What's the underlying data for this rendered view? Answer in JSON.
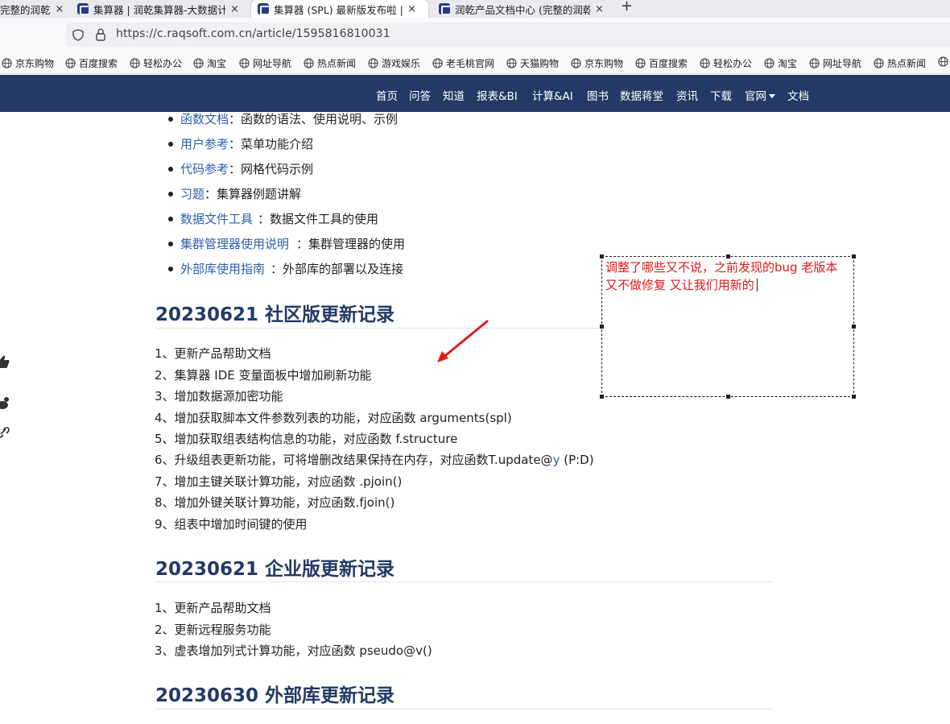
{
  "browser": {
    "tabs": [
      {
        "title": "完整的润乾",
        "active": false,
        "favicon": "none"
      },
      {
        "title": "集算器 | 润乾集算器-大数据计算",
        "active": false,
        "favicon": "raqsoft-icon"
      },
      {
        "title": "集算器 (SPL) 最新版发布啦 | 乾学",
        "active": true,
        "favicon": "raqsoft-icon"
      },
      {
        "title": "润乾产品文档中心 (完整的润乾",
        "active": false,
        "favicon": "raqsoft-icon"
      }
    ],
    "tab_close": "×",
    "new_tab": "+",
    "url": "https://c.raqsoft.com.cn/article/1595816810031",
    "bookmarks": [
      "京东购物",
      "百度搜索",
      "轻松办公",
      "淘宝",
      "网址导航",
      "热点新闻",
      "游戏娱乐",
      "老毛桃官网",
      "天猫购物",
      "京东购物",
      "百度搜索",
      "轻松办公",
      "淘宝",
      "网址导航",
      "热点新闻"
    ]
  },
  "site_nav": {
    "items": [
      "首页",
      "问答",
      "知道",
      "报表&BI",
      "计算&AI",
      "图书",
      "数据蒋堂",
      "资讯",
      "下载",
      "官网",
      "文档"
    ]
  },
  "doc_links": [
    {
      "link": "函数文档",
      "desc": "：函数的语法、使用说明、示例"
    },
    {
      "link": "用户参考",
      "desc": "：菜单功能介绍"
    },
    {
      "link": "代码参考",
      "desc": "：网格代码示例"
    },
    {
      "link": "习题",
      "desc": "：集算器例题讲解"
    },
    {
      "link": "数据文件工具",
      "desc": "：数据文件工具的使用"
    },
    {
      "link": "集群管理器使用说明",
      "desc": "：集群管理器的使用"
    },
    {
      "link": "外部库使用指南",
      "desc": "：外部库的部署以及连接"
    }
  ],
  "sections": [
    {
      "title": "20230621 社区版更新记录",
      "records": [
        "1、更新产品帮助文档",
        "2、集算器 IDE 变量面板中增加刷新功能",
        "3、增加数据源加密功能",
        "4、增加获取脚本文件参数列表的功能，对应函数 arguments(spl)",
        "5、增加获取组表结构信息的功能，对应函数 f.structure",
        "6、升级组表更新功能，可将增删改结果保持在内存，对应函数T.update@",
        "7、增加主键关联计算功能，对应函数 .pjoin()",
        "8、增加外键关联计算功能，对应函数.fjoin()",
        "9、组表中增加时间键的使用"
      ],
      "record6_highlight": "y",
      "record6_tail": " (P:D)"
    },
    {
      "title": "20230621 企业版更新记录",
      "records": [
        "1、更新产品帮助文档",
        "2、更新远程服务功能",
        "3、虚表增加列式计算功能，对应函数 pseudo@v()"
      ]
    },
    {
      "title": "20230630 外部库更新记录",
      "records": []
    }
  ],
  "annotation": {
    "text": "调整了哪些又不说，之前发现的bug 老版本又不做修复 又让我们用新的",
    "color": "#e01a1a"
  },
  "colors": {
    "site_nav_bg": "#233a66",
    "link": "#2b5fad",
    "heading": "#233a66"
  }
}
